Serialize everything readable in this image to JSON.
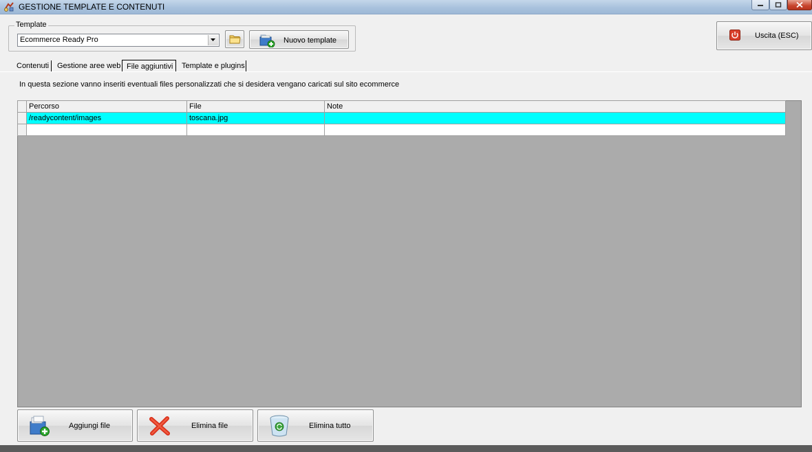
{
  "window": {
    "title": "GESTIONE TEMPLATE E CONTENUTI"
  },
  "template_group": {
    "legend": "Template",
    "selected": "Ecommerce Ready Pro",
    "new_template_label": "Nuovo template"
  },
  "exit_button": {
    "label": "Uscita (ESC)"
  },
  "tabs": [
    {
      "label": "Contenuti",
      "active": false
    },
    {
      "label": "Gestione aree web",
      "active": false
    },
    {
      "label": "File aggiuntivi",
      "active": true
    },
    {
      "label": "Template e plugins",
      "active": false
    }
  ],
  "info_text": "In questa sezione vanno inseriti eventuali files personalizzati che si desidera vengano caricati sul sito ecommerce",
  "grid": {
    "columns": [
      "Percorso",
      "File",
      "Note"
    ],
    "rows": [
      {
        "percorso": "/readycontent/images",
        "file": "toscana.jpg",
        "note": "",
        "selected": true
      },
      {
        "percorso": "",
        "file": "",
        "note": "",
        "selected": false
      }
    ]
  },
  "actions": {
    "add_file": "Aggiungi file",
    "delete_file": "Elimina file",
    "delete_all": "Elimina tutto"
  },
  "colors": {
    "selection": "#00ffff",
    "grid_background": "#ababab",
    "face": "#f0f0f0"
  }
}
